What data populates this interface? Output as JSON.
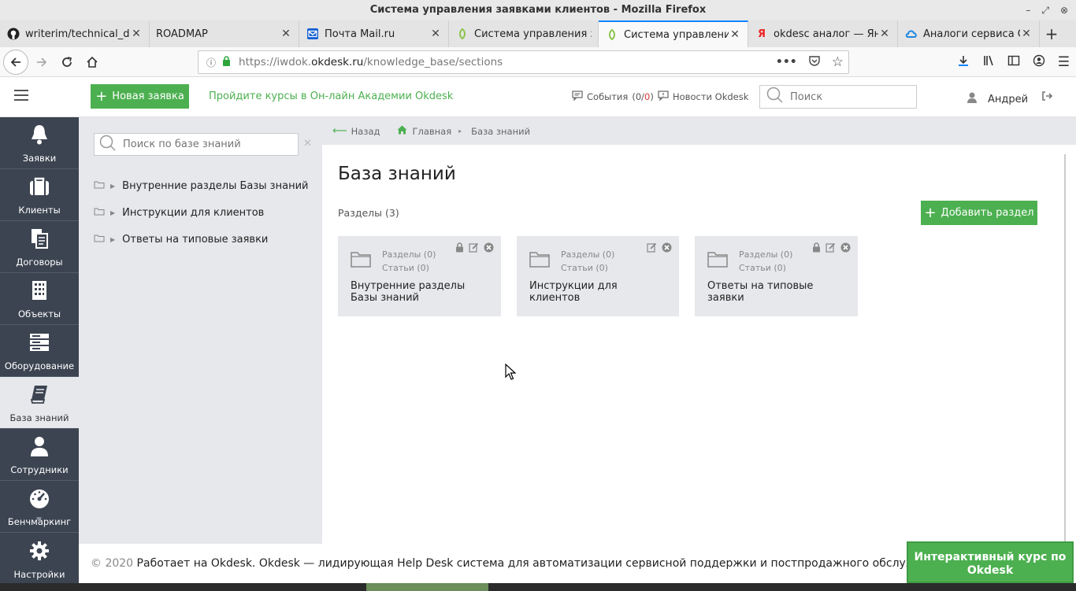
{
  "window": {
    "title": "Система управления заявками клиентов - Mozilla Firefox"
  },
  "tabs": [
    {
      "title": "writerim/technical_doc",
      "icon": "github-icon",
      "active": false
    },
    {
      "title": "ROADMAP",
      "icon": "none",
      "active": false
    },
    {
      "title": "Почта Mail.ru",
      "icon": "mail-icon",
      "active": false
    },
    {
      "title": "Система управления заявками",
      "icon": "okdesk-icon",
      "active": false
    },
    {
      "title": "Система управления заявками",
      "icon": "okdesk-icon",
      "active": true
    },
    {
      "title": "okdesc аналог — Яндекс",
      "icon": "yandex-icon",
      "active": false
    },
    {
      "title": "Аналоги сервиса Okdesk",
      "icon": "cloud-icon",
      "active": false
    }
  ],
  "url": {
    "prefix": "https://iwdok.",
    "host": "okdesk.ru",
    "path": "/knowledge_base/sections"
  },
  "header": {
    "new_ticket": "Новая заявка",
    "course_link": "Пройдите курсы в Он-лайн Академии Okdesk",
    "events_label": "События",
    "events_open": "(0/",
    "events_count": "0",
    "events_close": ")",
    "news": "Новости Okdesk",
    "search_placeholder": "Поиск",
    "user": "Андрей"
  },
  "sidebar": {
    "items": [
      {
        "label": "Заявки",
        "icon": "bell-icon",
        "active": false
      },
      {
        "label": "Клиенты",
        "icon": "briefcase-icon",
        "active": false
      },
      {
        "label": "Договоры",
        "icon": "documents-icon",
        "active": false
      },
      {
        "label": "Объекты",
        "icon": "building-icon",
        "active": false
      },
      {
        "label": "Оборудование",
        "icon": "server-icon",
        "active": false
      },
      {
        "label": "База знаний",
        "icon": "book-icon",
        "active": true
      },
      {
        "label": "Сотрудники",
        "icon": "person-icon",
        "active": false
      },
      {
        "label": "Бенчмаркинг",
        "icon": "gauge-icon",
        "active": false
      },
      {
        "label": "Настройки",
        "icon": "gear-icon",
        "active": false
      }
    ]
  },
  "kb_tree": {
    "search_placeholder": "Поиск по базе знаний",
    "items": [
      "Внутренние разделы Базы знаний",
      "Инструкции для клиентов",
      "Ответы на типовые заявки"
    ]
  },
  "breadcrumbs": {
    "back": "Назад",
    "home": "Главная",
    "current": "База знаний"
  },
  "main": {
    "title": "База знаний",
    "sections_count": "Разделы (3)",
    "add_button": "Добавить раздел",
    "cards": [
      {
        "sections": "Разделы (0)",
        "articles": "Статьи (0)",
        "title": "Внутренние разделы Базы знаний",
        "locked": true
      },
      {
        "sections": "Разделы (0)",
        "articles": "Статьи (0)",
        "title": "Инструкции для клиентов",
        "locked": false
      },
      {
        "sections": "Разделы (0)",
        "articles": "Статьи (0)",
        "title": "Ответы на типовые заявки",
        "locked": true
      }
    ]
  },
  "footer": {
    "copyright": "© 2020",
    "text": "Работает на Okdesk. Okdesk — лидирующая Help Desk система для автоматизации сервисной поддержки и постпродажного обслуживания"
  },
  "course_button": "Интерактивный курс по Okdesk",
  "colors": {
    "accent_green": "#4cb050",
    "sidebar_bg": "#3c4451",
    "panel_bg": "#e6e8eb",
    "alert_red": "#e03b3b"
  }
}
